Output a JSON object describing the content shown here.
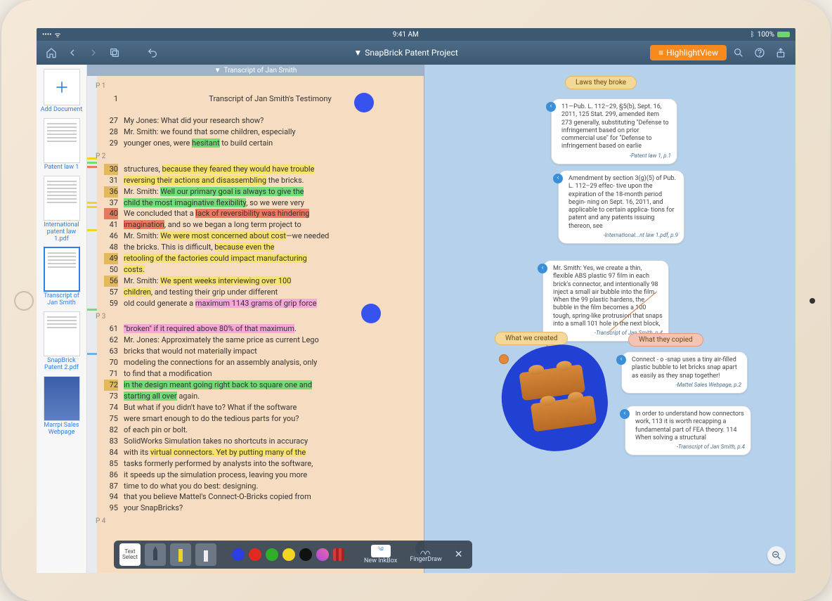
{
  "statusbar": {
    "time": "9:41 AM",
    "battery": "100%"
  },
  "toolbar": {
    "project_title": "SnapBrick Patent Project",
    "highlight_view": "HighlightView"
  },
  "sidebar": {
    "add_label": "Add Document",
    "items": [
      {
        "label": "Patent law 1"
      },
      {
        "label": "International patent law 1.pdf"
      },
      {
        "label": "Transcript of Jan Smith"
      },
      {
        "label": "SnapBrick Patent 2.pdf"
      },
      {
        "label": "Marrpi Sales Webpage"
      }
    ]
  },
  "transcript": {
    "header": "Transcript of Jan Smith",
    "page_labels": [
      "P 1",
      "P 2",
      "P 3",
      "P 4"
    ],
    "title_line_num": "1",
    "title_line": "Transcript of Jan Smith's Testimony",
    "lines": [
      {
        "n": "27",
        "segs": [
          {
            "t": "My Jones: What did your research show?"
          }
        ]
      },
      {
        "n": "28",
        "segs": [
          {
            "t": "Mr. Smith: we found that some children, especially"
          }
        ]
      },
      {
        "n": "29",
        "segs": [
          {
            "t": "younger ones, were "
          },
          {
            "t": "hesitant",
            "c": "hl-g"
          },
          {
            "t": " to build certain"
          }
        ]
      }
    ],
    "p2": [
      {
        "n": "30",
        "nh": "numHL",
        "segs": [
          {
            "t": "structures, "
          },
          {
            "t": "because they feared they would have trouble",
            "c": "hl-y"
          }
        ]
      },
      {
        "n": "31",
        "segs": [
          {
            "t": "reversing their actions and disassembling",
            "c": "hl-y"
          },
          {
            "t": " the bricks."
          }
        ]
      },
      {
        "n": "36",
        "nh": "numHL",
        "segs": [
          {
            "t": "Mr. Smith: "
          },
          {
            "t": "Well our primary goal is always to give the",
            "c": "hl-g"
          }
        ]
      },
      {
        "n": "37",
        "segs": [
          {
            "t": "child the most imaginative flexibility",
            "c": "hl-g"
          },
          {
            "t": ", so we were very"
          }
        ]
      },
      {
        "n": "40",
        "nh": "numHLr",
        "segs": [
          {
            "t": "We concluded that a "
          },
          {
            "t": "lack of reversibility was hindering",
            "c": "hl-r"
          }
        ]
      },
      {
        "n": "41",
        "segs": [
          {
            "t": "imagination",
            "c": "hl-r"
          },
          {
            "t": ", and so we began a long term project to"
          }
        ]
      },
      {
        "n": "46",
        "segs": [
          {
            "t": "Mr. Smith: "
          },
          {
            "t": "We were most concerned about cost",
            "c": "hl-y"
          },
          {
            "t": "—we needed"
          }
        ]
      },
      {
        "n": "48",
        "segs": [
          {
            "t": "the bricks. This is difficult, "
          },
          {
            "t": "because even the",
            "c": "hl-y"
          }
        ]
      },
      {
        "n": "49",
        "nh": "numHL",
        "segs": [
          {
            "t": "retooling of the factories could impact manufacturing",
            "c": "hl-y"
          }
        ]
      },
      {
        "n": "50",
        "segs": [
          {
            "t": "costs.",
            "c": "hl-y"
          }
        ]
      },
      {
        "n": "56",
        "nh": "numHL",
        "segs": [
          {
            "t": "Mr. Smith: "
          },
          {
            "t": "We spent weeks interviewing over 100",
            "c": "hl-y"
          }
        ]
      },
      {
        "n": "57",
        "segs": [
          {
            "t": "children",
            "c": "hl-y"
          },
          {
            "t": ", and testing their grip under different"
          }
        ]
      },
      {
        "n": "59",
        "segs": [
          {
            "t": "old could generate a "
          },
          {
            "t": "maximum 1143 grams of grip force",
            "c": "hl-p"
          }
        ]
      }
    ],
    "p3": [
      {
        "n": "61",
        "segs": [
          {
            "t": "\"broken\" if it required above 80% of that maximum",
            "c": "hl-p"
          },
          {
            "t": "."
          }
        ]
      },
      {
        "n": "62",
        "segs": [
          {
            "t": "Mr. Jones: Approximately the same price as current Lego"
          }
        ]
      },
      {
        "n": "63",
        "segs": [
          {
            "t": "bricks that would not materially impact"
          }
        ]
      },
      {
        "n": "70",
        "segs": [
          {
            "t": "modeling the connections for an assembly analysis, only"
          }
        ]
      },
      {
        "n": "71",
        "segs": [
          {
            "t": "to find that a modification"
          }
        ]
      },
      {
        "n": "72",
        "nh": "numHL",
        "segs": [
          {
            "t": "in the design meant going right back to square one and",
            "c": "hl-g"
          }
        ]
      },
      {
        "n": "73",
        "segs": [
          {
            "t": "starting all over",
            "c": "hl-g"
          },
          {
            "t": " again."
          }
        ]
      },
      {
        "n": "74",
        "segs": [
          {
            "t": "But what if you didn't have to? What if the software"
          }
        ]
      },
      {
        "n": "75",
        "segs": [
          {
            "t": "were smart enough to do the tedious parts for you?"
          }
        ]
      },
      {
        "n": "82",
        "segs": [
          {
            "t": "of each pin or bolt."
          }
        ]
      },
      {
        "n": "83",
        "segs": [
          {
            "t": "SolidWorks Simulation takes no shortcuts in accuracy"
          }
        ]
      },
      {
        "n": "84",
        "segs": [
          {
            "t": "with its "
          },
          {
            "t": "virtual connectors. Yet by putting many of the",
            "c": "hl-y"
          }
        ]
      },
      {
        "n": "85",
        "segs": [
          {
            "t": "tasks formerly performed by analysts into the software,"
          }
        ]
      },
      {
        "n": "86",
        "segs": [
          {
            "t": "it speeds up the simulation process, leaving you more"
          }
        ]
      },
      {
        "n": "87",
        "segs": [
          {
            "t": "time to do what you do best: designing."
          }
        ]
      },
      {
        "n": "94",
        "segs": [
          {
            "t": "that you believe Mattel's Connect-O-Bricks copied from"
          }
        ]
      },
      {
        "n": "95",
        "segs": [
          {
            "t": "your SnapBricks?"
          }
        ]
      }
    ]
  },
  "badges": {
    "laws": "Laws they broke",
    "created": "What we created",
    "copied": "What they copied"
  },
  "notes": {
    "n1": {
      "text": "11—Pub. L. 112–29, §5(b), Sept. 16, 2011, 125 Stat. 299, amended item 273 generally, substituting \"Defense to infringement based on prior commercial use\" for \"Defense to infringement based on earlie",
      "src": "-Patent law 1, p.1"
    },
    "n2": {
      "text": "Amendment by section 3(g)(5) of Pub. L. 112–29 effec- tive upon the expiration of the 18-month period begin- ning on Sept. 16, 2011, and applicable to certain applica- tions for patent and any patents issuing thereon, see",
      "src": "-International...nt law 1.pdf, p.9"
    },
    "n3": {
      "text": "Mr. Smith: Yes, we create a thin, flexible ABS plastic 97 film in each brick's connector, and intentionally 98 inject a small air bubble into the film. When the 99 plastic hardens, the bubble in the film becomes a 100 tough, spring-like protrusion that snaps into a small 101 hole in the next block,",
      "src": "-Transcript of Jan Smith, p.4"
    },
    "n4": {
      "text": "Connect - o -snap uses a tiny air-filled plastic bubble to let bricks snap apart as easily as they snap together!",
      "src": "-Mattel Sales Webpage, p.2"
    },
    "n5": {
      "text": "In order to understand how connectors work, 113 it is worth recapping a fundamental part of FEA theory. 114 When solving a structural",
      "src": "-Transcript of Jan Smith, p.4"
    }
  },
  "bottom_toolbar": {
    "text_select": "Text Select",
    "new_inkbox": "New InkBox",
    "fingerdraw": "FingerDraw",
    "colors": [
      "#2b3fe0",
      "#e12a1f",
      "#2fae2a",
      "#f3d321",
      "#111",
      "#b246dc",
      "#d63a3a"
    ]
  }
}
